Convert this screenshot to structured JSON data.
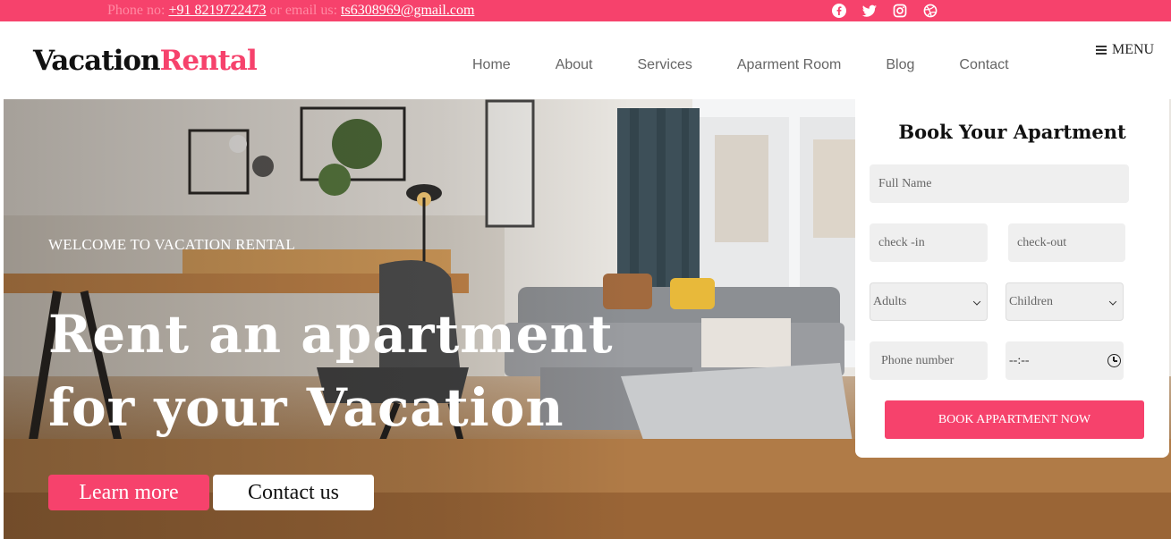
{
  "topbar": {
    "phone_label": "Phone no: ",
    "phone": "+91 8219722473",
    "email_label": " or email us: ",
    "email": "ts6308969@gmail.com",
    "socials": [
      "facebook-icon",
      "twitter-icon",
      "instagram-icon",
      "dribbble-icon"
    ]
  },
  "brand": {
    "part1": "Vacation",
    "part2": "Rental"
  },
  "nav": {
    "home": "Home",
    "about": "About",
    "services": "Services",
    "room": "Aparment Room",
    "blog": "Blog",
    "contact": "Contact"
  },
  "menu_label": "MENU",
  "hero": {
    "welcome": "WELCOME TO VACATION RENTAL",
    "headline": "Rent an apartment for your Vacation",
    "learn_more": "Learn more",
    "contact_us": "Contact us"
  },
  "booking": {
    "title": "Book Your Apartment",
    "full_name_placeholder": "Full Name",
    "check_in_placeholder": "check -in",
    "check_out_placeholder": "check-out",
    "adults": "Adults",
    "children": "Children",
    "phone_placeholder": "Phone number",
    "time_value": "--:--",
    "submit": "BOOK APPARTMENT NOW"
  },
  "colors": {
    "accent": "#f6426c",
    "field_bg": "#efefef"
  }
}
